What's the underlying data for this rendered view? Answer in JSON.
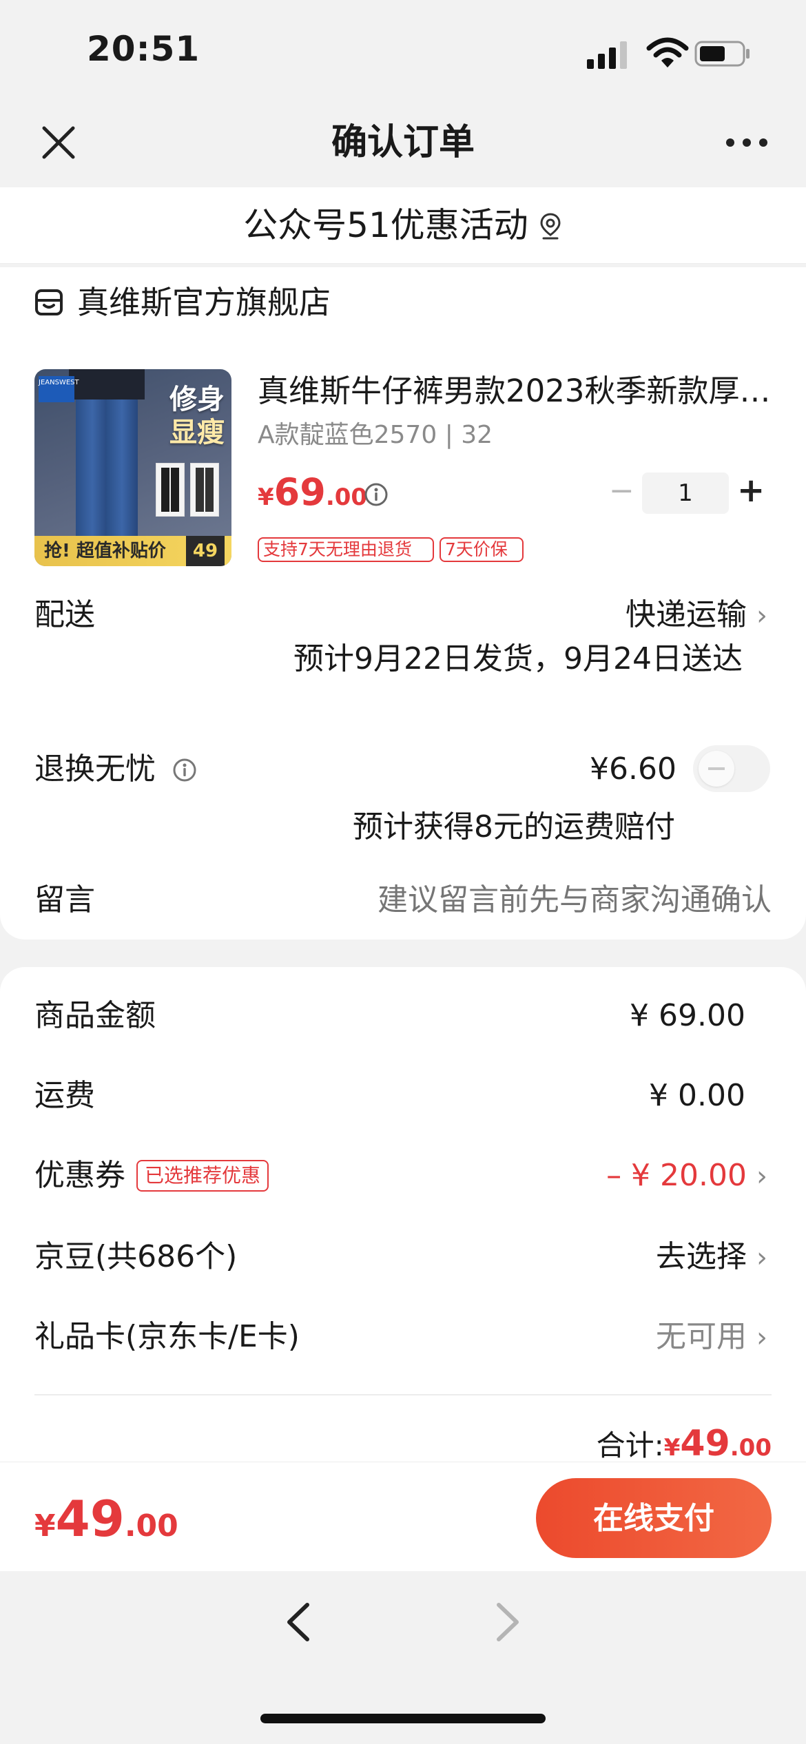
{
  "status_bar": {
    "time": "20:51",
    "signal_icon": "cellular-signal-icon",
    "wifi_icon": "wifi-icon",
    "battery_icon": "battery-icon"
  },
  "nav": {
    "title": "确认订单",
    "close_icon": "close-icon",
    "more_icon": "more-icon"
  },
  "promo": {
    "text": "公众号51优惠活动",
    "icon": "location-pin-icon"
  },
  "store": {
    "name": "真维斯官方旗舰店",
    "icon": "store-icon",
    "product": {
      "image_slogan_1": "修身",
      "image_slogan_2": "显瘦",
      "image_banner": "抢! 超值补贴价",
      "image_price": "49",
      "image_logo": "JEANSWEST",
      "title": "真维斯牛仔裤男款2023秋季新款厚…",
      "variant": "A款靛蓝色2570 | 32",
      "price_symbol": "¥",
      "price_int": "69",
      "price_dec": ".00",
      "quantity": "1",
      "minus_label": "−",
      "plus_label": "+",
      "tags": [
        "支持7天无理由退货",
        "7天价保"
      ]
    },
    "delivery": {
      "label": "配送",
      "method": "快递运输",
      "estimate": "预计9月22日发货，9月24日送达"
    },
    "return_service": {
      "label": "退换无忧",
      "price": "¥6.60",
      "note": "预计获得8元的运费赔付",
      "enabled": false
    },
    "message": {
      "label": "留言",
      "placeholder": "建议留言前先与商家沟通确认"
    }
  },
  "summary": {
    "goods_label": "商品金额",
    "goods_value": "¥ 69.00",
    "freight_label": "运费",
    "freight_value": "¥ 0.00",
    "coupon_label": "优惠券",
    "coupon_tag": "已选推荐优惠",
    "coupon_value": "– ¥ 20.00",
    "beans_label": "京豆(共686个)",
    "beans_value": "去选择",
    "gift_label": "礼品卡(京东卡/E卡)",
    "gift_value": "无可用",
    "subtotal_label": "合计:",
    "subtotal_symbol": "¥",
    "subtotal_int": "49",
    "subtotal_dec": ".00",
    "chevron": "›"
  },
  "pay_bar": {
    "total_symbol": "¥",
    "total_int": "49",
    "total_dec": ".00",
    "pay_button": "在线支付"
  },
  "browser": {
    "back_icon": "back-chevron-icon",
    "forward_icon": "forward-chevron-icon"
  },
  "colors": {
    "accent_red": "#e4393c",
    "pay_gradient_start": "#ec4a2d",
    "pay_gradient_end": "#f26844",
    "page_bg": "#f2f2f2"
  }
}
